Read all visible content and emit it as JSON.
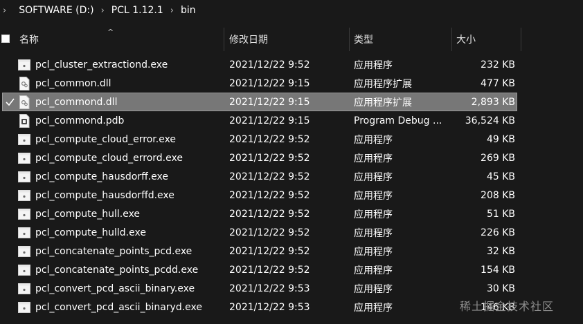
{
  "breadcrumb": {
    "items": [
      "SOFTWARE (D:)",
      "PCL 1.12.1",
      "bin"
    ]
  },
  "columns": {
    "name": "名称",
    "date": "修改日期",
    "type": "类型",
    "size": "大小"
  },
  "files": [
    {
      "name": "pcl_cluster_extractiond.exe",
      "date": "2021/12/22 9:52",
      "type": "应用程序",
      "size": "232 KB",
      "icon": "exe-icon"
    },
    {
      "name": "pcl_common.dll",
      "date": "2021/12/22 9:15",
      "type": "应用程序扩展",
      "size": "477 KB",
      "icon": "dll-icon"
    },
    {
      "name": "pcl_commond.dll",
      "date": "2021/12/22 9:15",
      "type": "应用程序扩展",
      "size": "2,893 KB",
      "icon": "dll-icon",
      "selected": true
    },
    {
      "name": "pcl_commond.pdb",
      "date": "2021/12/22 9:15",
      "type": "Program Debug ...",
      "size": "36,524 KB",
      "icon": "pdb-icon"
    },
    {
      "name": "pcl_compute_cloud_error.exe",
      "date": "2021/12/22 9:52",
      "type": "应用程序",
      "size": "49 KB",
      "icon": "exe-icon"
    },
    {
      "name": "pcl_compute_cloud_errord.exe",
      "date": "2021/12/22 9:52",
      "type": "应用程序",
      "size": "269 KB",
      "icon": "exe-icon"
    },
    {
      "name": "pcl_compute_hausdorff.exe",
      "date": "2021/12/22 9:52",
      "type": "应用程序",
      "size": "45 KB",
      "icon": "exe-icon"
    },
    {
      "name": "pcl_compute_hausdorffd.exe",
      "date": "2021/12/22 9:52",
      "type": "应用程序",
      "size": "208 KB",
      "icon": "exe-icon"
    },
    {
      "name": "pcl_compute_hull.exe",
      "date": "2021/12/22 9:52",
      "type": "应用程序",
      "size": "51 KB",
      "icon": "exe-icon"
    },
    {
      "name": "pcl_compute_hulld.exe",
      "date": "2021/12/22 9:52",
      "type": "应用程序",
      "size": "226 KB",
      "icon": "exe-icon"
    },
    {
      "name": "pcl_concatenate_points_pcd.exe",
      "date": "2021/12/22 9:52",
      "type": "应用程序",
      "size": "32 KB",
      "icon": "exe-icon"
    },
    {
      "name": "pcl_concatenate_points_pcdd.exe",
      "date": "2021/12/22 9:52",
      "type": "应用程序",
      "size": "154 KB",
      "icon": "exe-icon"
    },
    {
      "name": "pcl_convert_pcd_ascii_binary.exe",
      "date": "2021/12/22 9:53",
      "type": "应用程序",
      "size": "30 KB",
      "icon": "exe-icon"
    },
    {
      "name": "pcl_convert_pcd_ascii_binaryd.exe",
      "date": "2021/12/22 9:53",
      "type": "应用程序",
      "size": "146 KB",
      "icon": "exe-icon"
    }
  ],
  "watermark": "稀土掘金技术社区",
  "colors": {
    "background": "#191919",
    "selected_row": "#777777",
    "text": "#ffffff"
  }
}
